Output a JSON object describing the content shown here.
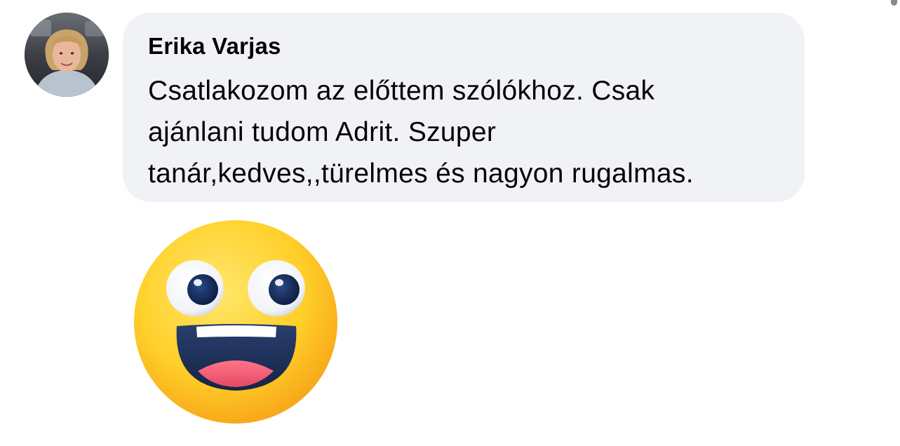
{
  "comment": {
    "author": "Erika Varjas",
    "text": "Csatlakozom az előttem szólókhoz. Csak\najánlani tudom Adrit. Szuper\ntanár,kedves,,türelmes és nagyon rugalmas."
  },
  "icons": {
    "avatar": "profile-photo",
    "emoji": "grinning-face-with-big-eyes-sticker"
  },
  "colors": {
    "bubble_background": "#f0f2f5",
    "text": "#050505",
    "emoji_yellow": "#ffd22e"
  }
}
